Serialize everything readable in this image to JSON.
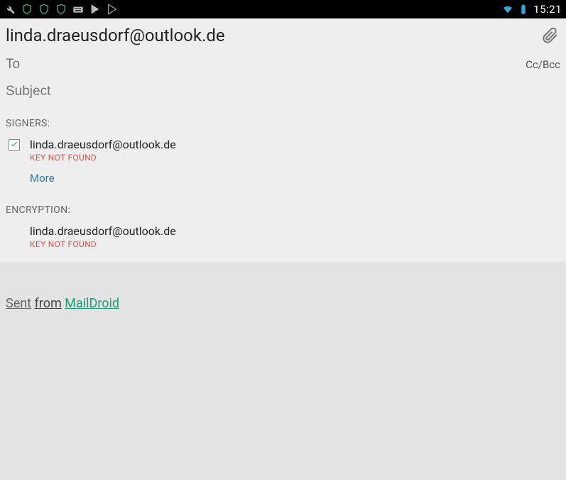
{
  "statusbar": {
    "time": "15:21"
  },
  "compose": {
    "from": "linda.draeusdorf@outlook.de",
    "to_placeholder": "To",
    "ccbcc_label": "Cc/Bcc",
    "subject_placeholder": "Subject"
  },
  "signers": {
    "label": "SIGNERS:",
    "email": "linda.draeusdorf@outlook.de",
    "key_status": "KEY NOT FOUND",
    "more_label": "More"
  },
  "encryption": {
    "label": "ENCRYPTION:",
    "email": "linda.draeusdorf@outlook.de",
    "key_status": "KEY NOT FOUND"
  },
  "signature": {
    "sent": "Sent",
    "from": "from",
    "app": "MailDroid"
  }
}
